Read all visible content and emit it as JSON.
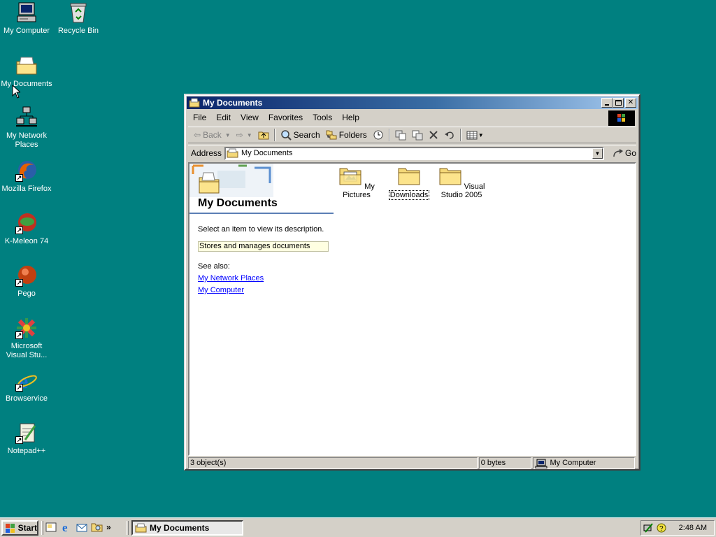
{
  "desktop": {
    "icons": [
      {
        "label": "My Computer"
      },
      {
        "label": "Recycle Bin"
      },
      {
        "label": "My Documents"
      },
      {
        "label": "My Network Places"
      },
      {
        "label": "Mozilla Firefox"
      },
      {
        "label": "K-Meleon 74"
      },
      {
        "label": "Pego"
      },
      {
        "label": "Microsoft Visual Stu..."
      },
      {
        "label": "Browservice"
      },
      {
        "label": "Notepad++"
      }
    ]
  },
  "window": {
    "title": "My Documents",
    "menu": [
      "File",
      "Edit",
      "View",
      "Favorites",
      "Tools",
      "Help"
    ],
    "toolbar": {
      "back": "Back",
      "search": "Search",
      "folders": "Folders"
    },
    "address": {
      "label": "Address",
      "value": "My Documents",
      "go": "Go"
    },
    "left_pane": {
      "title": "My Documents",
      "prompt": "Select an item to view its description.",
      "description": "Stores and manages documents",
      "see_also": "See also:",
      "links": [
        "My Network Places",
        "My Computer"
      ]
    },
    "items": [
      {
        "label": "My Pictures"
      },
      {
        "label": "Downloads"
      },
      {
        "label": "Visual Studio 2005"
      }
    ],
    "status": {
      "objects": "3 object(s)",
      "size": "0 bytes",
      "zone": "My Computer"
    }
  },
  "taskbar": {
    "start": "Start",
    "task": "My Documents",
    "clock": "2:48 AM",
    "chevron": "»"
  },
  "colors": {
    "desktop": "#008080",
    "title_active": "#0a246a",
    "face": "#d4d0c8"
  }
}
